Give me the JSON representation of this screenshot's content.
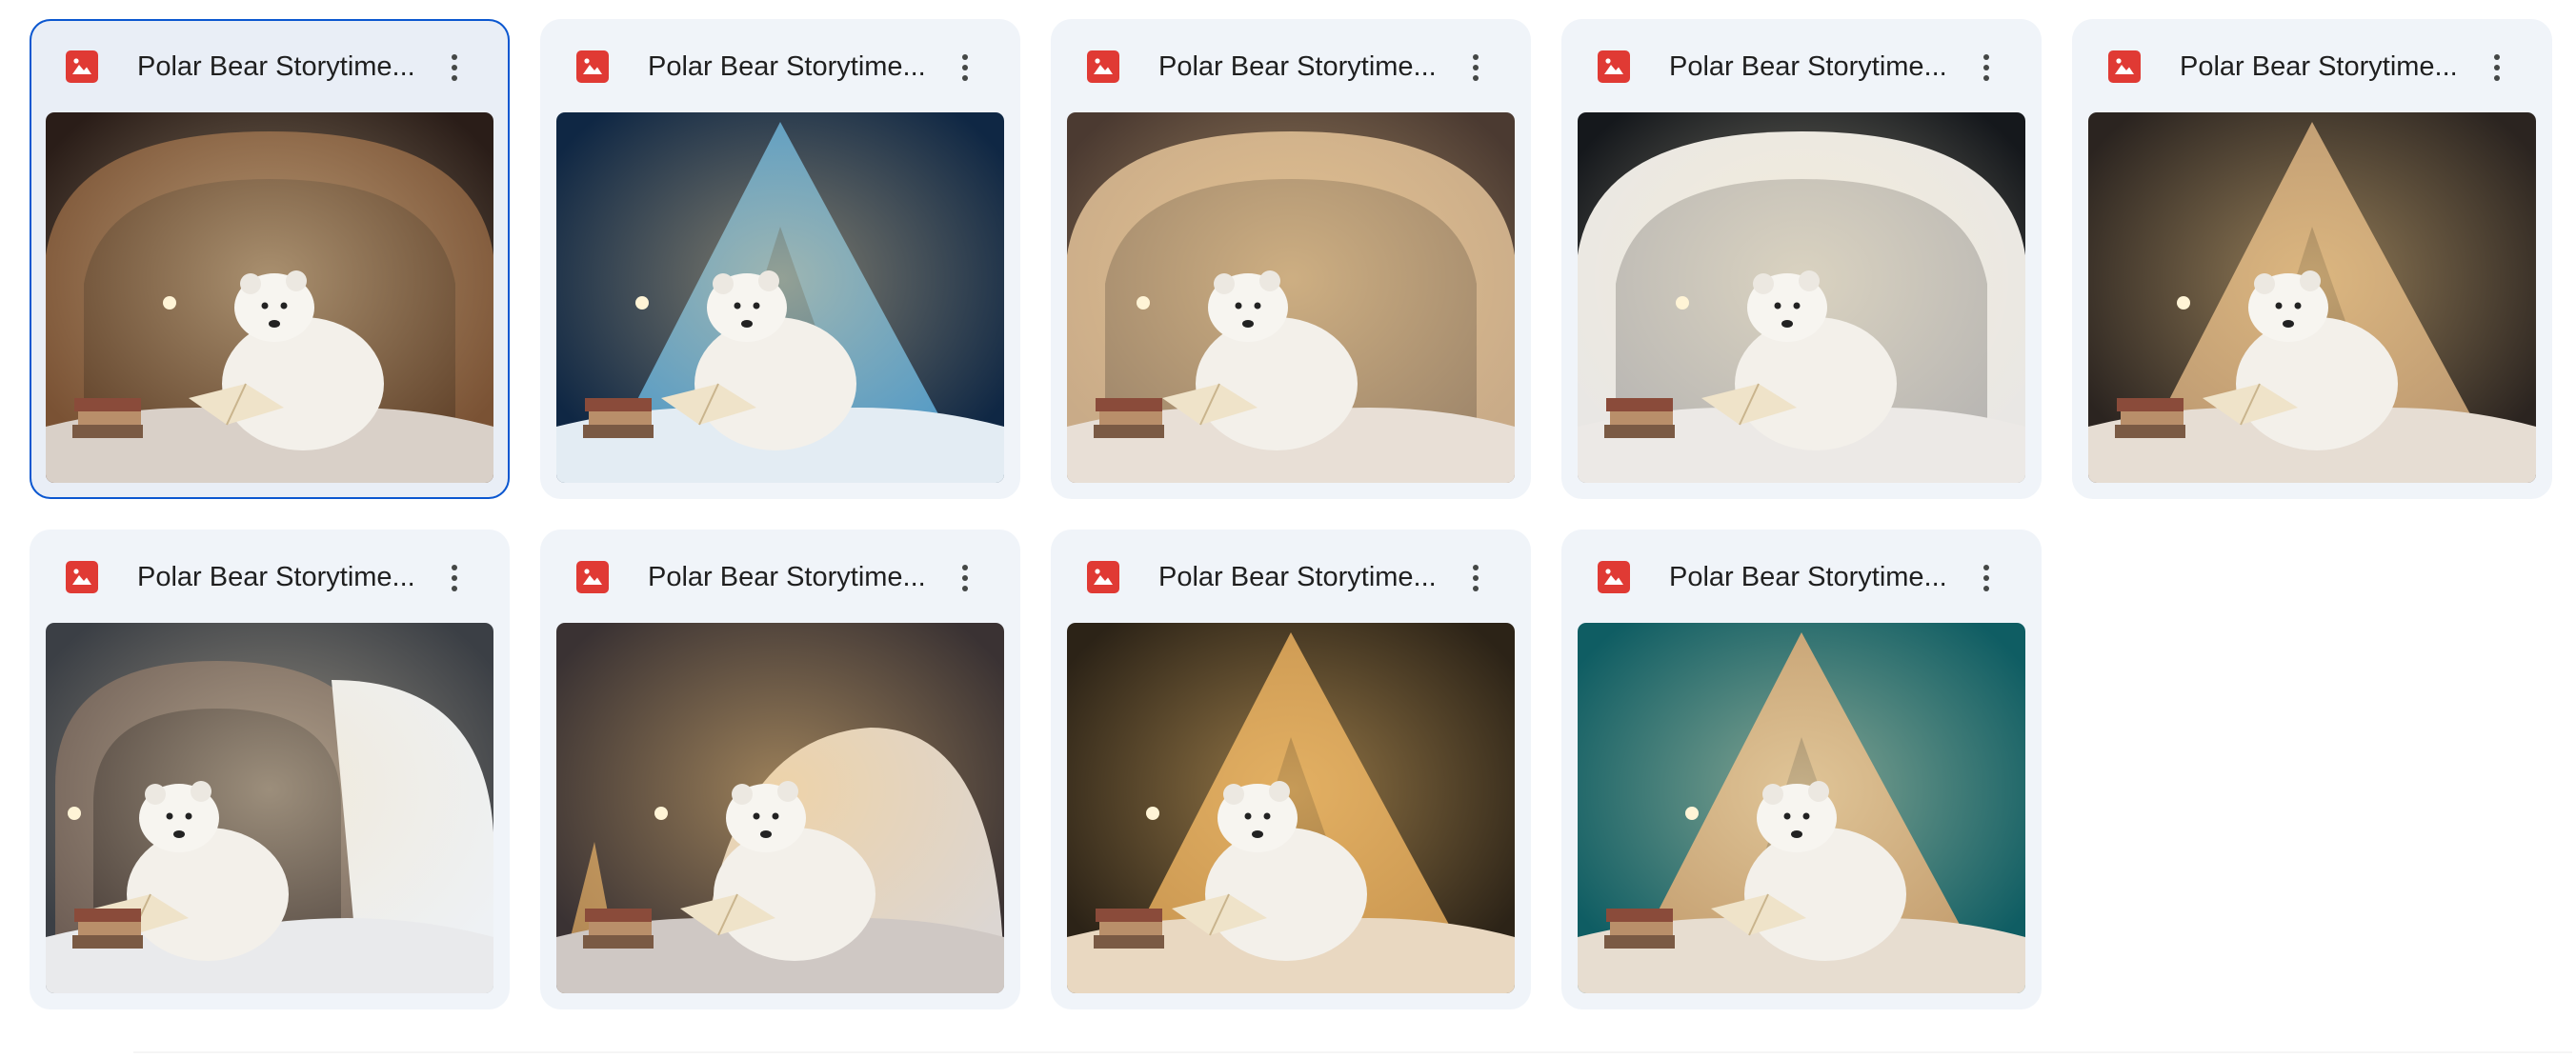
{
  "files": [
    {
      "title": "Polar Bear Storytime...",
      "icon": "image-file-icon",
      "selected": true,
      "scene": "wooden-hut",
      "sky": "#2a1d18",
      "shelter": "#7a5234",
      "glow": "#f6e2b8",
      "floor": "#d9d0c8"
    },
    {
      "title": "Polar Bear Storytime...",
      "icon": "image-file-icon",
      "selected": false,
      "scene": "blue-tent",
      "sky": "#0f2744",
      "shelter": "#4a97c9",
      "glow": "#f4d59a",
      "floor": "#e3ecf3"
    },
    {
      "title": "Polar Bear Storytime...",
      "icon": "image-file-icon",
      "selected": false,
      "scene": "branch-dome",
      "sky": "#4b3a31",
      "shelter": "#c9ab88",
      "glow": "#ffd99b",
      "floor": "#e8dfd6"
    },
    {
      "title": "Polar Bear Storytime...",
      "icon": "image-file-icon",
      "selected": false,
      "scene": "snow-cave",
      "sky": "#15181c",
      "shelter": "#e9e7e4",
      "glow": "#fff2cf",
      "floor": "#ece9e6"
    },
    {
      "title": "Polar Bear Storytime...",
      "icon": "image-file-icon",
      "selected": false,
      "scene": "canvas-tent",
      "sky": "#2b2420",
      "shelter": "#b99670",
      "glow": "#ffd790",
      "floor": "#e6ddd3"
    },
    {
      "title": "Polar Bear Storytime...",
      "icon": "image-file-icon",
      "selected": false,
      "scene": "stone-arch",
      "sky": "#3b3f45",
      "shelter": "#6f5f56",
      "glow": "#f2e1c0",
      "floor": "#e9eaec"
    },
    {
      "title": "Polar Bear Storytime...",
      "icon": "image-file-icon",
      "selected": false,
      "scene": "snow-mound",
      "sky": "#3a3233",
      "shelter": "#dcd6d2",
      "glow": "#ffcf80",
      "floor": "#cfc8c4"
    },
    {
      "title": "Polar Bear Storytime...",
      "icon": "image-file-icon",
      "selected": false,
      "scene": "amber-tent",
      "sky": "#2c2317",
      "shelter": "#c7944f",
      "glow": "#ffcc77",
      "floor": "#e9d8c1"
    },
    {
      "title": "Polar Bear Storytime...",
      "icon": "image-file-icon",
      "selected": false,
      "scene": "lit-teepee",
      "sky": "#0f5d63",
      "shelter": "#c19a6b",
      "glow": "#fff0c4",
      "floor": "#e7ddd0"
    }
  ],
  "menu_icon": "more-vert-icon"
}
